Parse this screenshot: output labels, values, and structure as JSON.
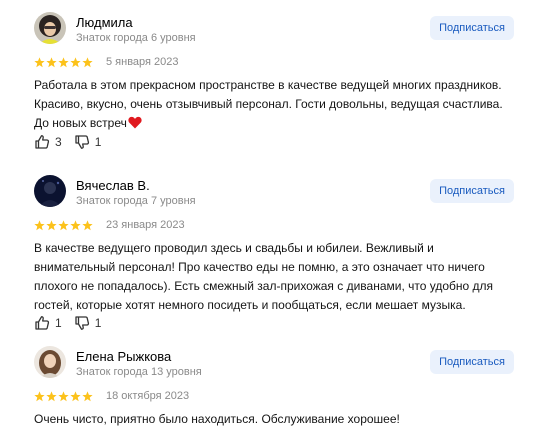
{
  "subscribe_label": "Подписаться",
  "colors": {
    "star": "#fcc21b",
    "subscribe_bg": "#eaf1fc",
    "subscribe_text": "#1a5bbf",
    "heart": "#e0191f",
    "muted": "#8a8a8a"
  },
  "reviews": [
    {
      "author": "Людмила",
      "level": "Знаток города 6 уровня",
      "rating": 5,
      "date": "5 января 2023",
      "text": "Работала в этом прекрасном пространстве в качестве ведущей многих праздников. Красиво, вкусно, очень отзывчивый персонал. Гости довольны, ведущая счастлива. До новых встреч",
      "emoji": "heart",
      "likes": "3",
      "dislikes": "1"
    },
    {
      "author": "Вячеслав В.",
      "level": "Знаток города 7 уровня",
      "rating": 5,
      "date": "23 января 2023",
      "text": "В качестве ведущего проводил здесь и свадьбы и юбилеи. Вежливый и внимательный персонал! Про качество еды не помню, а это означает что ничего плохого не попадалось). Есть смежный зал-прихожая с диванами, что удобно для гостей, которые хотят немного посидеть и пообщаться, если мешает музыка.",
      "likes": "1",
      "dislikes": "1"
    },
    {
      "author": "Елена Рыжкова",
      "level": "Знаток города 13 уровня",
      "rating": 5,
      "date": "18 октября 2023",
      "text": "Очень чисто, приятно было находиться. Обслуживание хорошее!"
    }
  ]
}
